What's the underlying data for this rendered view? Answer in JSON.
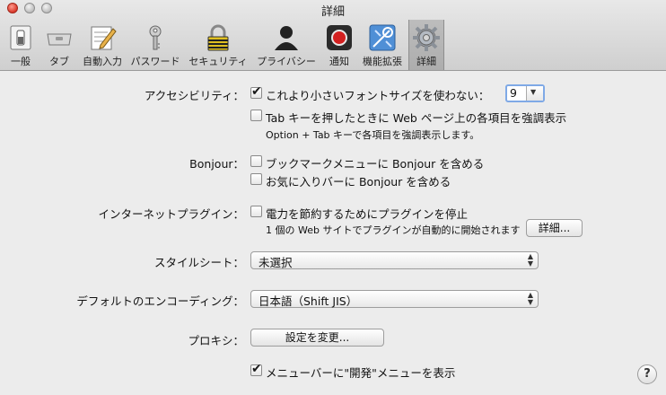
{
  "window": {
    "title": "詳細"
  },
  "toolbar": {
    "items": [
      {
        "label": "一般",
        "icon": "switch-icon"
      },
      {
        "label": "タブ",
        "icon": "tabs-icon"
      },
      {
        "label": "自動入力",
        "icon": "pencil-form-icon"
      },
      {
        "label": "パスワード",
        "icon": "key-icon"
      },
      {
        "label": "セキュリティ",
        "icon": "padlock-icon"
      },
      {
        "label": "プライバシー",
        "icon": "silhouette-icon"
      },
      {
        "label": "通知",
        "icon": "record-icon"
      },
      {
        "label": "機能拡張",
        "icon": "extensions-icon"
      },
      {
        "label": "詳細",
        "icon": "gear-icon",
        "selected": true
      }
    ]
  },
  "accessibility": {
    "label": "アクセシビリティ：",
    "min_font_label": "これより小さいフォントサイズを使わない：",
    "min_font_checked": true,
    "min_font_value": "9",
    "tab_label": "Tab キーを押したときに Web ページ上の各項目を強調表示",
    "tab_checked": false,
    "tab_note": "Option + Tab キーで各項目を強調表示します。"
  },
  "bonjour": {
    "label": "Bonjour：",
    "bookmarks_label": "ブックマークメニューに Bonjour を含める",
    "favorites_label": "お気に入りバーに Bonjour を含める"
  },
  "plugins": {
    "label": "インターネットプラグイン：",
    "power_label": "電力を節約するためにプラグインを停止",
    "note": "1 個の Web サイトでプラグインが自動的に開始されます",
    "details_button": "詳細..."
  },
  "stylesheet": {
    "label": "スタイルシート：",
    "value": "未選択"
  },
  "encoding": {
    "label": "デフォルトのエンコーディング：",
    "value": "日本語（Shift JIS）"
  },
  "proxy": {
    "label": "プロキシ：",
    "button": "設定を変更..."
  },
  "develop": {
    "label": "メニューバーに\"開発\"メニューを表示",
    "checked": true
  },
  "help": {
    "label": "?"
  },
  "colors": {
    "focus_ring": "#7fa9e6",
    "close": "#d9382a"
  }
}
